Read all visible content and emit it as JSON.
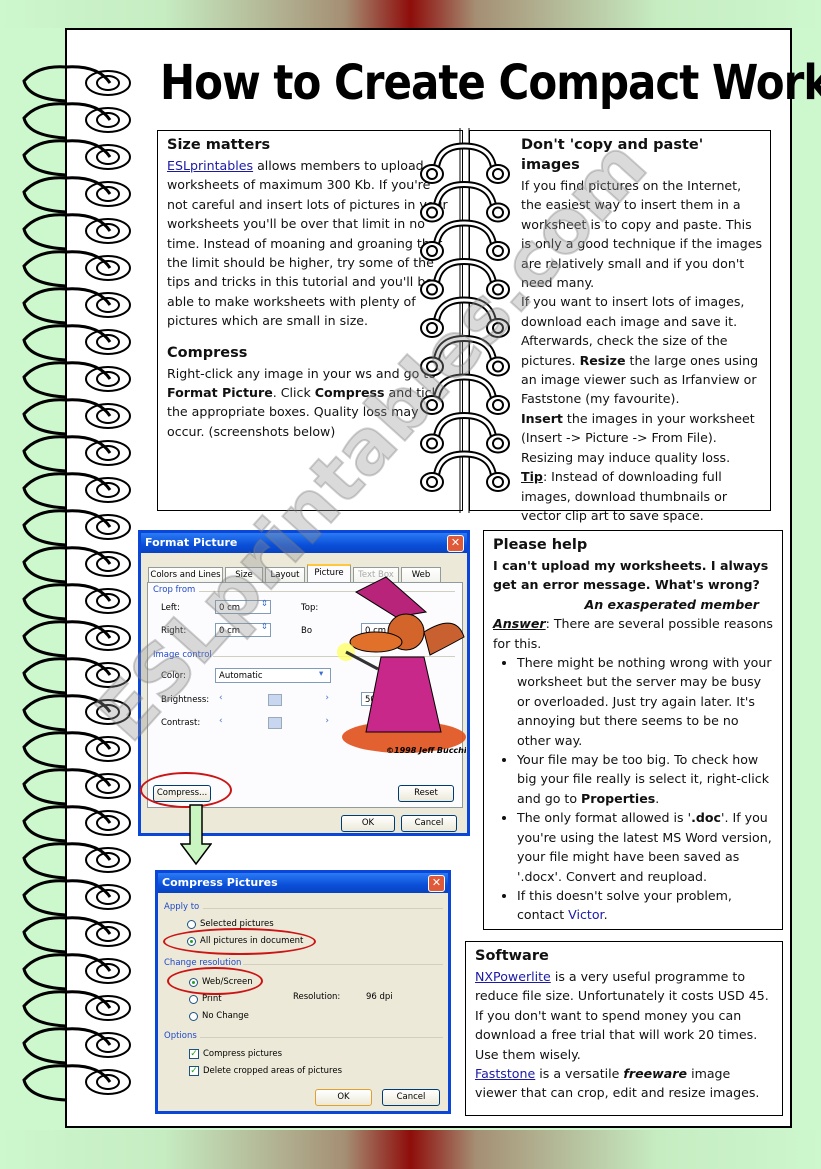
{
  "title": "How to Create Compact Worksheets",
  "watermark": "ESLprintables.com",
  "colors": {
    "background_green": "#cdf7cd",
    "background_red": "#8e0d0b",
    "link_blue": "#1a1aa6",
    "highlight_red": "#cc1414",
    "arrow_green": "#c8f5c0",
    "xp_title_blue": "#0a4fd8"
  },
  "size_matters": {
    "heading": "Size matters",
    "link": "ESLprintables",
    "text": " allows members to upload worksheets of maximum 300 Kb. If you're not careful and insert lots of pictures in your worksheets you'll be over that limit in no time. Instead of moaning and groaning that the limit should be higher, try some of the tips and tricks in this tutorial and you'll be able to make worksheets with plenty of pictures which are small in size."
  },
  "compress": {
    "heading": "Compress",
    "t1": "Right-click any image in your ws and go to ",
    "b1": "Format Picture",
    "t2": ". Click ",
    "b2": "Compress",
    "t3": " and tick the appropriate boxes. Quality loss may occur. (screenshots below)"
  },
  "copy_paste": {
    "heading": "Don't 'copy and paste' images",
    "p1": "If you find pictures on the Internet, the easiest way to insert them in a worksheet is to copy and paste. This is only a good technique if the images are relatively small and if you don't need many.",
    "p2": "If you want to insert lots of images, download each image and save it. Afterwards, check the size of the pictures. ",
    "p2_bold": "Resize",
    "p2_end": " the large ones using an image viewer such as Irfanview or Faststone (my favourite).",
    "p3_bold": "Insert",
    "p3": " the images in your worksheet (Insert -> Picture -> From File). Resizing may induce quality loss.",
    "tip_label": "Tip",
    "tip": ": Instead of downloading full images, download thumbnails or vector clip art to save space."
  },
  "please_help": {
    "heading": "Please help",
    "question": "I can't upload my worksheets. I always get an error message. What's wrong?",
    "signature": "An exasperated member",
    "answer_label": "Answer",
    "answer": ": There are several possible reasons for this.",
    "bullets": [
      {
        "text": "There might be nothing wrong with your worksheet but the server may be busy or overloaded. Just try again later. It's annoying but there seems to be no other way."
      },
      {
        "text": "Your file may be too big. To check how big your file really is select it, right-click and go to ",
        "bold": "Properties",
        "after": "."
      },
      {
        "text": "The only format allowed is '",
        "bold": ".doc",
        "after": "'. If you you're using the latest MS Word version, your file might have been saved as '.docx'. Convert and reupload."
      },
      {
        "text": "If this doesn't solve your problem, contact ",
        "link": "Victor",
        "after": "."
      }
    ]
  },
  "software": {
    "heading": "Software",
    "link1": "NXPowerlite",
    "p1": " is a very useful programme to reduce file size. Unfortunately it costs USD 45. If you don't want to spend money you can download a free trial that will work 20 times. Use them wisely.",
    "link2": "Faststone",
    "p2a": " is a versatile ",
    "p2_bold": "freeware",
    "p2b": " image viewer that can crop, edit and resize images."
  },
  "format_picture_dialog": {
    "title": "Format Picture",
    "tabs": [
      "Colors and Lines",
      "Size",
      "Layout",
      "Picture",
      "Text Box",
      "Web"
    ],
    "active_tab": "Picture",
    "crop_section": "Crop from",
    "left_label": "Left:",
    "left_value": "0 cm",
    "right_label": "Right:",
    "right_value": "0 cm",
    "top_label": "Top:",
    "bottom_label": "Bo",
    "bottom_value": "0 cm",
    "image_section": "Image control",
    "color_label": "Color:",
    "color_value": "Automatic",
    "brightness_label": "Brightness:",
    "brightness_value": "50 %",
    "brightness_level": 0.5,
    "contrast_label": "Contrast:",
    "contrast_level": 0.5,
    "compress_button": "Compress...",
    "reset_button": "Reset",
    "ok_button": "OK",
    "cancel_button": "Cancel",
    "clipart_credit": "©1998  Jeff Bucchino"
  },
  "compress_pictures_dialog": {
    "title": "Compress Pictures",
    "apply_section": "Apply to",
    "apply_options": [
      {
        "label": "Selected pictures",
        "checked": false
      },
      {
        "label": "All pictures in document",
        "checked": true
      }
    ],
    "resolution_section": "Change resolution",
    "resolution_options": [
      {
        "label": "Web/Screen",
        "checked": true
      },
      {
        "label": "Print",
        "checked": false
      },
      {
        "label": "No Change",
        "checked": false
      }
    ],
    "resolution_label": "Resolution:",
    "resolution_value": "96 dpi",
    "options_section": "Options",
    "options": [
      {
        "label": "Compress pictures",
        "checked": true
      },
      {
        "label": "Delete cropped areas of pictures",
        "checked": true
      }
    ],
    "ok_button": "OK",
    "cancel_button": "Cancel"
  }
}
